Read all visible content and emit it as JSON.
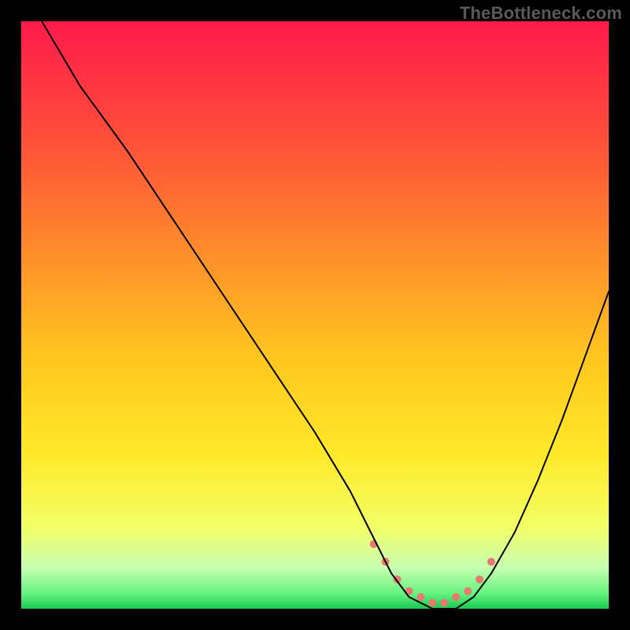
{
  "watermark": "TheBottleneck.com",
  "chart_data": {
    "type": "line",
    "title": "",
    "xlabel": "",
    "ylabel": "",
    "xlim": [
      0,
      100
    ],
    "ylim": [
      0,
      100
    ],
    "grid": false,
    "legend": false,
    "background_gradient": {
      "stops": [
        {
          "offset": 0.0,
          "color": "#ff1a4b"
        },
        {
          "offset": 0.2,
          "color": "#ff4f3a"
        },
        {
          "offset": 0.4,
          "color": "#ff8f2a"
        },
        {
          "offset": 0.58,
          "color": "#ffc81f"
        },
        {
          "offset": 0.74,
          "color": "#ffe92a"
        },
        {
          "offset": 0.86,
          "color": "#f3ff66"
        },
        {
          "offset": 0.93,
          "color": "#c7ffb0"
        },
        {
          "offset": 0.975,
          "color": "#63f27e"
        },
        {
          "offset": 1.0,
          "color": "#17c94f"
        }
      ]
    },
    "series": [
      {
        "name": "bottleneck-curve",
        "stroke": "#000000",
        "stroke_width": 2,
        "x": [
          3.5,
          10,
          18,
          26,
          34,
          42,
          50,
          56,
          60,
          63,
          66,
          70,
          74,
          77,
          80,
          84,
          88,
          92,
          96,
          100
        ],
        "values": [
          100,
          89,
          78,
          66,
          54,
          42,
          30,
          20,
          12,
          6,
          2,
          0,
          0,
          2,
          6,
          13,
          22,
          32,
          43,
          54
        ]
      }
    ],
    "markers": {
      "name": "valley-highlight",
      "color": "#e77a70",
      "radius": 5,
      "x": [
        60,
        62,
        64,
        66,
        68,
        70,
        72,
        74,
        76,
        78,
        80
      ],
      "values": [
        11,
        8,
        5,
        3,
        2,
        1,
        1,
        2,
        3,
        5,
        8
      ]
    }
  }
}
